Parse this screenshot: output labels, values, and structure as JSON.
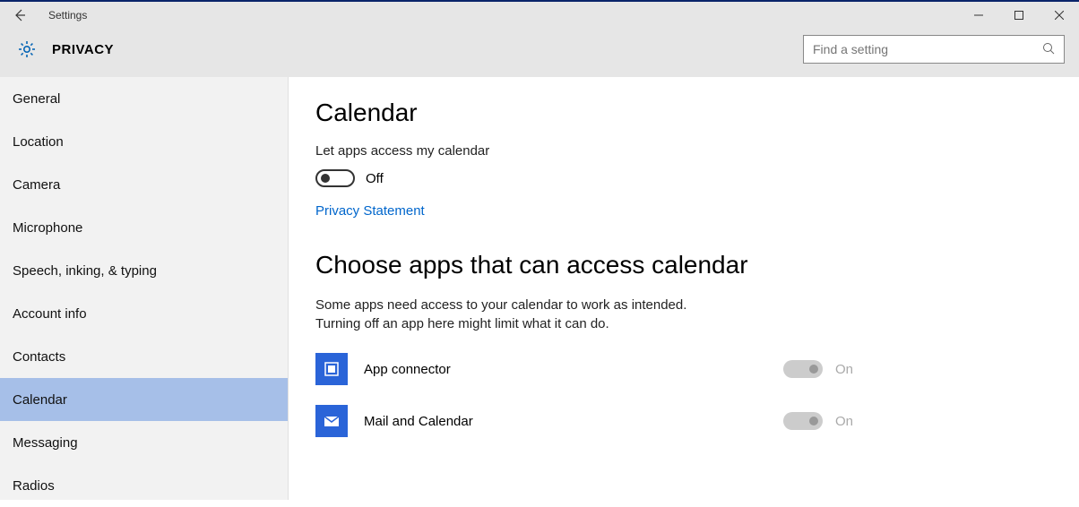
{
  "window": {
    "title": "Settings"
  },
  "header": {
    "page_label": "PRIVACY",
    "search_placeholder": "Find a setting"
  },
  "sidebar": {
    "items": [
      {
        "label": "General"
      },
      {
        "label": "Location"
      },
      {
        "label": "Camera"
      },
      {
        "label": "Microphone"
      },
      {
        "label": "Speech, inking, & typing"
      },
      {
        "label": "Account info"
      },
      {
        "label": "Contacts"
      },
      {
        "label": "Calendar",
        "selected": true
      },
      {
        "label": "Messaging"
      },
      {
        "label": "Radios"
      }
    ]
  },
  "main": {
    "title": "Calendar",
    "access_label": "Let apps access my calendar",
    "access_toggle_state": "Off",
    "privacy_link": "Privacy Statement",
    "choose_title": "Choose apps that can access calendar",
    "choose_desc_line1": "Some apps need access to your calendar to work as intended.",
    "choose_desc_line2": "Turning off an app here might limit what it can do.",
    "apps": [
      {
        "name": "App connector",
        "state": "On",
        "icon": "app-connector"
      },
      {
        "name": "Mail and Calendar",
        "state": "On",
        "icon": "mail"
      }
    ]
  }
}
